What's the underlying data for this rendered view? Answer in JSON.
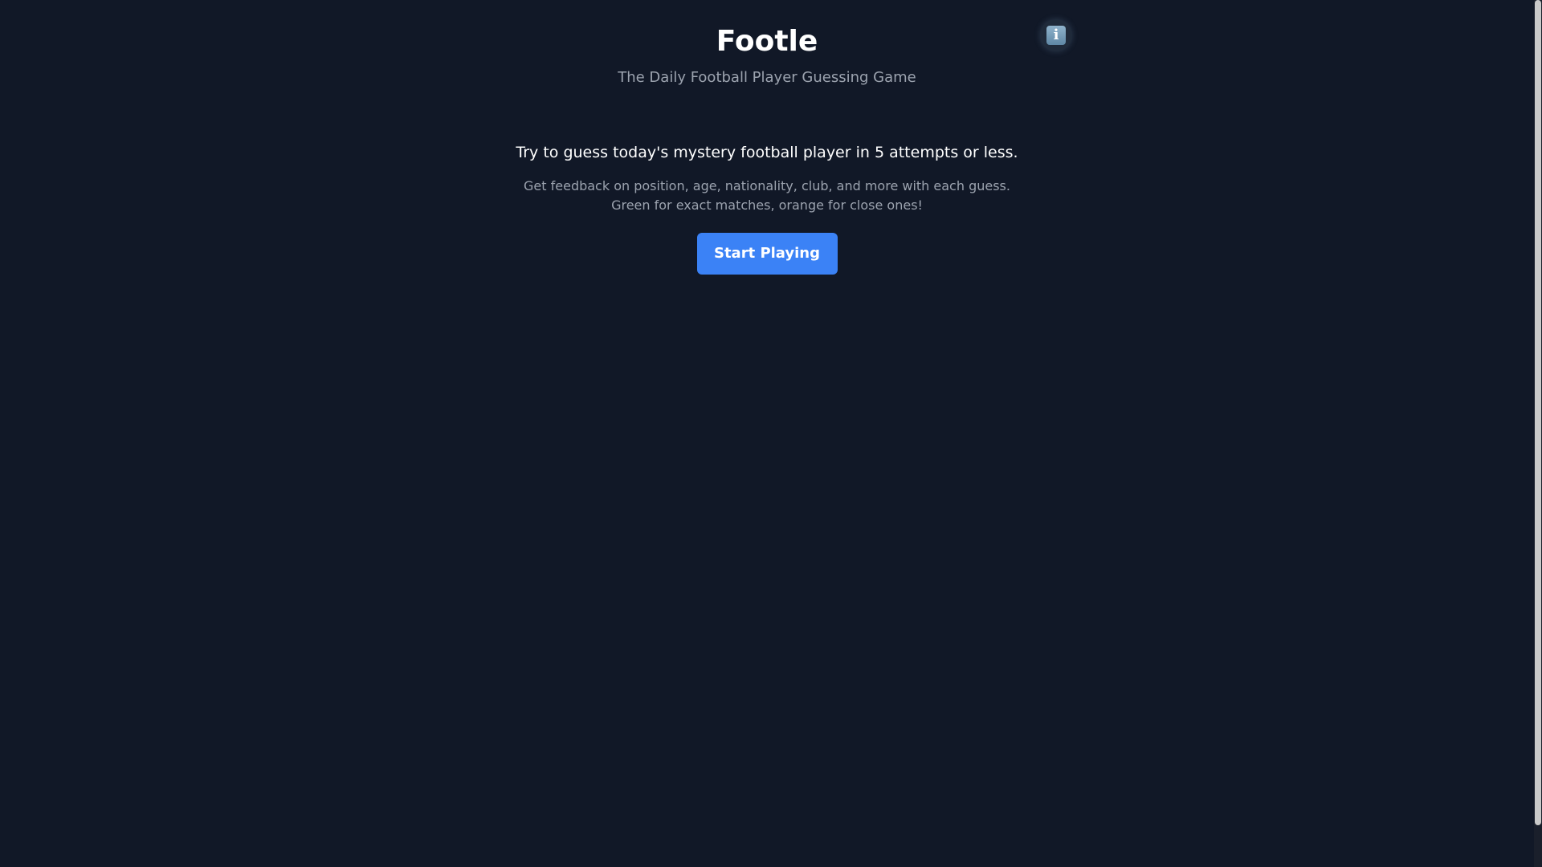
{
  "app": {
    "title": "Footle",
    "subtitle": "The Daily Football Player Guessing Game"
  },
  "info_button": {
    "icon": "info-icon",
    "glyph": "i"
  },
  "intro": {
    "headline": "Try to guess today's mystery football player in 5 attempts or less.",
    "line1": "Get feedback on position, age, nationality, club, and more with each guess.",
    "line2": "Green for exact matches, orange for close ones!"
  },
  "actions": {
    "start_label": "Start Playing"
  },
  "colors": {
    "background": "#111827",
    "accent": "#3b82f6",
    "muted_text": "#9ca3af",
    "text": "#ffffff"
  }
}
